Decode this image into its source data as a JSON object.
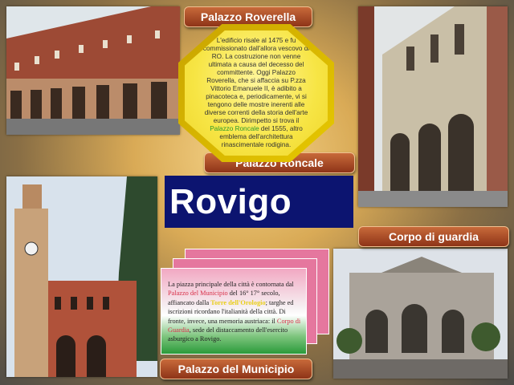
{
  "labels": {
    "roverella": "Palazzo Roverella",
    "roncale": "Palazzo Roncale",
    "corpo": "Corpo di guardia",
    "municipio": "Palazzo del Municipio"
  },
  "title": "Rovigo",
  "octagon": {
    "before": "L'edificio risale al 1475 e fu commissionato dall'allora vescovo di RO. La costruzione non venne ultimata a causa del decesso del committente. Oggi Palazzo Roverella, che si affaccia su P.zza Vittorio Emanuele II, è adibito a pinacoteca e, periodicamente, vi si tengono delle mostre inerenti alle diverse correnti della storia dell'arte europea. Dirimpetto si trova il ",
    "link": "Palazzo Roncale",
    "after": " del 1555, altro emblema dell'architettura rinascimentale rodigina."
  },
  "card": {
    "t1": "La piazza principale della città è contornata dal",
    "t1_hl": "Palazzo del Municipio",
    "t2": " del 16° 17° secolo, affiancato dalla ",
    "t2_hl": "Torre dell'Orologio",
    "t3": "; targhe ed iscrizioni ricordano l'italianità della città. Di fronte, invece, una memoria austriaca: il ",
    "t3_hl": "Corpo di Guardia",
    "t4": ", sede del distaccamento dell'esercito asburgico a Rovigo."
  }
}
